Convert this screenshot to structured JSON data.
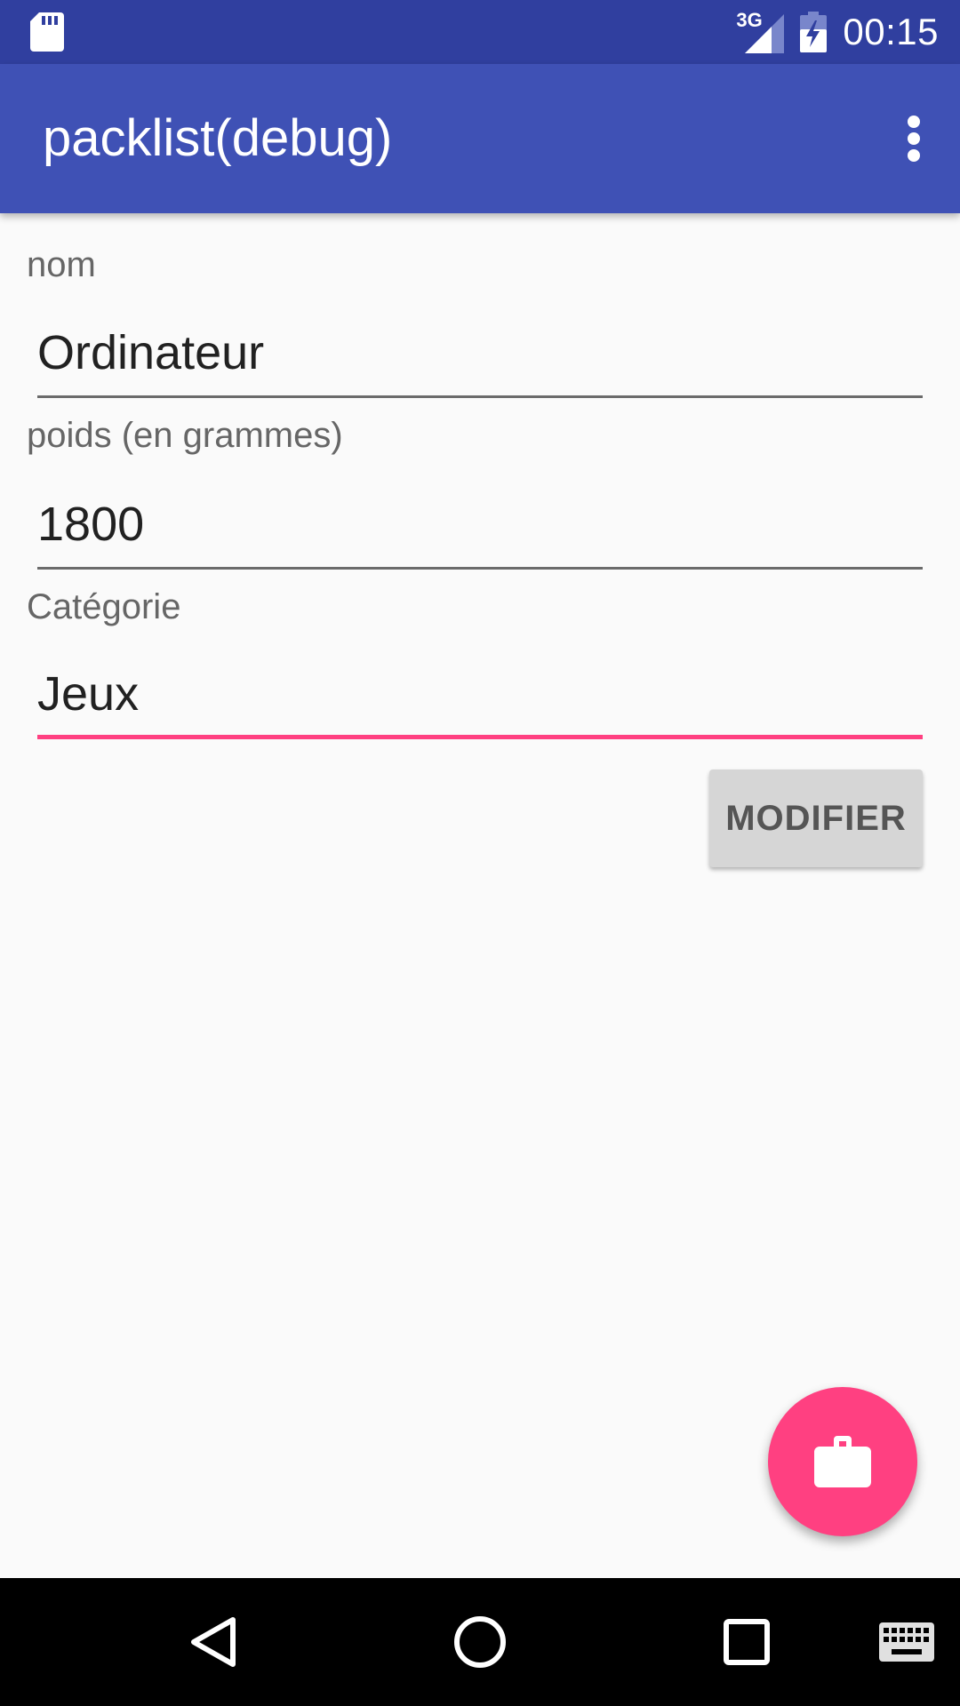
{
  "status_bar": {
    "left_icon": "sd-card-icon",
    "network_label": "3G",
    "signal_icon": "cell-signal-icon",
    "battery_icon": "battery-charging-icon",
    "time": "00:15",
    "background_color": "#303f9f"
  },
  "app_bar": {
    "title": "packlist(debug)",
    "overflow_icon": "more-vert-icon",
    "background_color": "#3f51b5"
  },
  "form": {
    "name_field": {
      "label": "nom",
      "value": "Ordinateur"
    },
    "weight_field": {
      "label": "poids (en grammes)",
      "value": "1800"
    },
    "category_field": {
      "label": "Catégorie",
      "value": "Jeux",
      "focused": true
    },
    "submit_label": "MODIFIER"
  },
  "fab": {
    "icon": "briefcase-icon",
    "color": "#ff4081"
  },
  "nav_bar": {
    "back_icon": "back-triangle-icon",
    "home_icon": "home-circle-icon",
    "recents_icon": "recents-square-icon",
    "keyboard_icon": "keyboard-icon"
  },
  "colors": {
    "accent": "#ff4081",
    "primary": "#3f51b5",
    "primary_dark": "#303f9f"
  }
}
